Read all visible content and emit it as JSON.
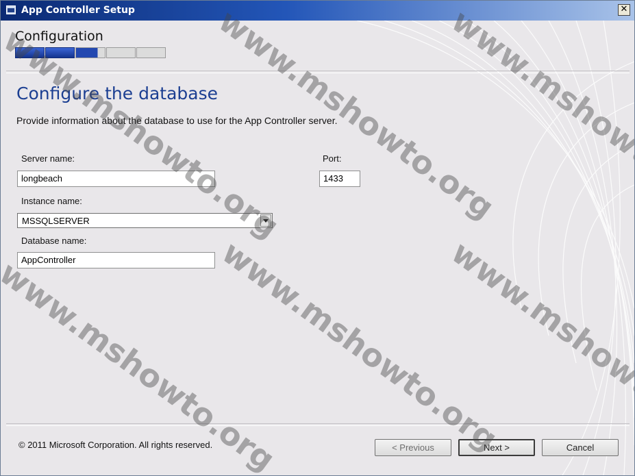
{
  "window": {
    "title": "App Controller Setup",
    "close_glyph": "✕"
  },
  "header": {
    "step_title": "Configuration",
    "progress": {
      "total_steps": 5,
      "completed_steps": 2.75
    }
  },
  "page": {
    "heading": "Configure the database",
    "description": "Provide information about the database to use for the App Controller server."
  },
  "form": {
    "server_name": {
      "label": "Server name:",
      "value": "longbeach"
    },
    "port": {
      "label": "Port:",
      "value": "1433"
    },
    "instance_name": {
      "label": "Instance name:",
      "value": "MSSQLSERVER"
    },
    "database_name": {
      "label": "Database name:",
      "value": "AppController"
    }
  },
  "footer": {
    "copyright": "© 2011 Microsoft Corporation. All rights reserved.",
    "previous_label": "< Previous",
    "next_label": "Next >",
    "cancel_label": "Cancel"
  },
  "watermark": {
    "text": "www.mshowto.org"
  },
  "colors": {
    "heading": "#1c3f92",
    "titlebar_start": "#0b2a73",
    "progress_fill": "#2348b0"
  }
}
